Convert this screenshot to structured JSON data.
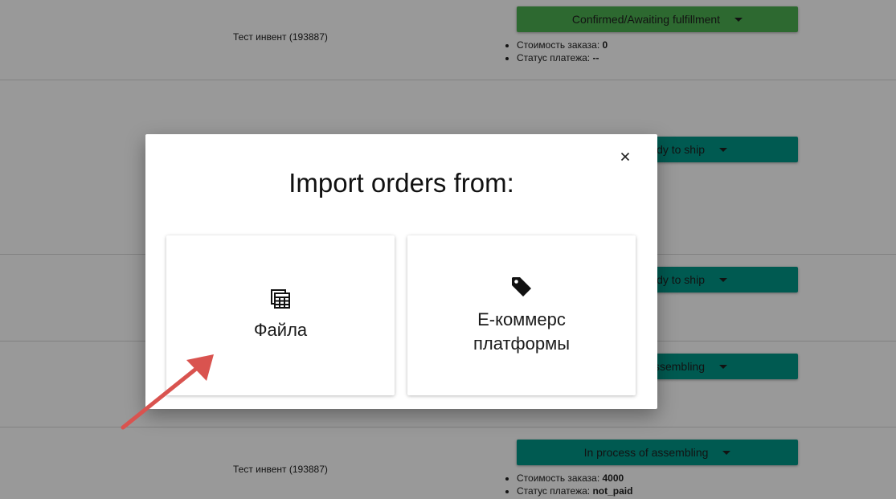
{
  "orders": [
    {
      "name": "Тест инвент (193887)",
      "status": "Confirmed/Awaiting fulfillment",
      "status_color": "#4caf50",
      "cost_label": "Стоимость заказа:",
      "cost_value": "0",
      "payment_label": "Статус платежа:",
      "payment_value": "--"
    },
    {
      "status_visible": "ady to ship",
      "status_color": "#009688"
    },
    {
      "status_visible": "ady to ship",
      "status_color": "#009688"
    },
    {
      "status_visible": "ssembling",
      "status_color": "#009688"
    },
    {
      "name": "Тест инвент (193887)",
      "status": "In process of assembling",
      "status_color": "#009688",
      "cost_label": "Стоимость заказа:",
      "cost_value": "4000",
      "payment_label": "Статус платежа:",
      "payment_value": "not_paid"
    }
  ],
  "modal": {
    "title": "Import orders from:",
    "close_icon": "close-icon",
    "options": [
      {
        "label": "Файла",
        "icon": "spreadsheet-icon"
      },
      {
        "label_line1": "E-коммерс",
        "label_line2": "платформы",
        "icon": "tag-icon"
      }
    ]
  },
  "annotation": {
    "arrow_color": "#d9534f"
  }
}
